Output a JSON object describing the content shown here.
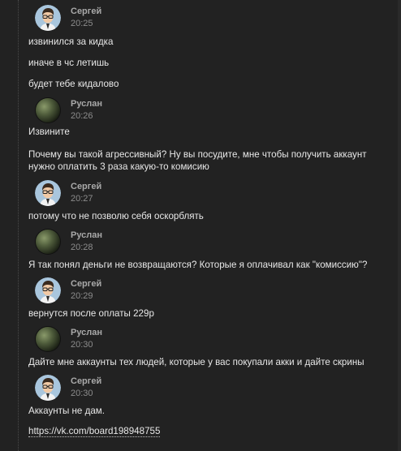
{
  "chat": {
    "groups": [
      {
        "author": "Сергей",
        "time": "20:25",
        "avatar": "cartoon-man-avatar",
        "lines": [
          "извинился за кидка",
          "иначе в чс летишь",
          "будет тебе кидалово"
        ]
      },
      {
        "author": "Руслан",
        "time": "20:26",
        "avatar": "planet-avatar",
        "lines": [
          "Извините",
          "Почему вы такой агрессивный? Ну вы посудите, мне чтобы получить аккаунт",
          "нужно оплатить 3 раза какую-то комисию"
        ]
      },
      {
        "author": "Сергей",
        "time": "20:27",
        "avatar": "cartoon-man-avatar",
        "lines": [
          "потому что не позволю себя оскорблять"
        ]
      },
      {
        "author": "Руслан",
        "time": "20:28",
        "avatar": "planet-avatar",
        "lines": [
          "Я так понял деньги не возвращаются? Которые я оплачивал как \"комиссию\"?"
        ]
      },
      {
        "author": "Сергей",
        "time": "20:29",
        "avatar": "cartoon-man-avatar",
        "lines": [
          "вернутся после оплаты 229р"
        ]
      },
      {
        "author": "Руслан",
        "time": "20:30",
        "avatar": "planet-avatar",
        "lines": [
          "Дайте мне аккаунты тех людей, которые у вас покупали акки и дайте скрины"
        ]
      },
      {
        "author": "Сергей",
        "time": "20:30",
        "avatar": "cartoon-man-avatar",
        "lines": [
          "Аккаунты не дам.",
          "https://vk.com/board198948755"
        ]
      }
    ]
  }
}
